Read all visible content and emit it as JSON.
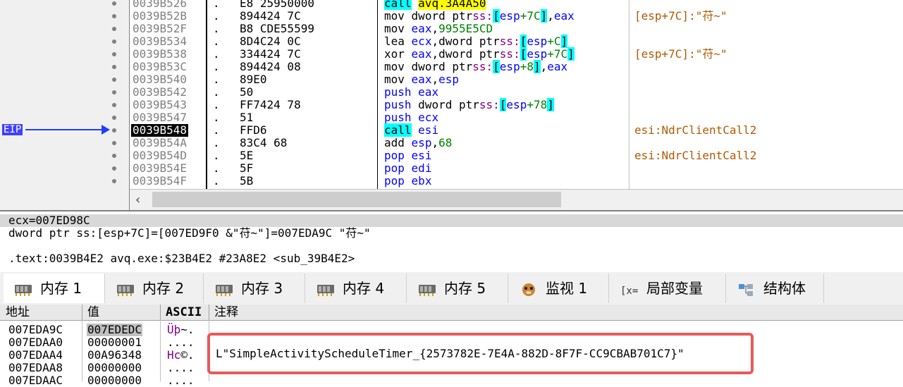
{
  "disasm": {
    "eip_label": "EIP",
    "rows": [
      {
        "addr": "0039B526",
        "sep": ".",
        "bytes": "E8 25950000",
        "mn": "call",
        "ops": [
          {
            "t": "avq.3A4A50",
            "c": "sym"
          }
        ],
        "cmt": ""
      },
      {
        "addr": "0039B52B",
        "sep": ".",
        "bytes": "894424 7C",
        "mn": "mov",
        "ops": [
          {
            "t": "dword ptr"
          },
          {
            "t": "ss:",
            "c": "seg"
          },
          {
            "t": "[",
            "c": "br"
          },
          {
            "t": "esp",
            "c": "reg"
          },
          {
            "t": "+7C",
            "c": "num"
          },
          {
            "t": "]",
            "c": "br"
          },
          {
            "t": ","
          },
          {
            "t": "eax",
            "c": "reg"
          }
        ],
        "cmt": "[esp+7C]:\"苻~\""
      },
      {
        "addr": "0039B52F",
        "sep": ".",
        "bytes": "B8 CDE55599",
        "mn": "mov",
        "ops": [
          {
            "t": "eax",
            "c": "reg"
          },
          {
            "t": ","
          },
          {
            "t": "9955E5CD",
            "c": "num"
          }
        ],
        "cmt": ""
      },
      {
        "addr": "0039B534",
        "sep": ".",
        "bytes": "8D4C24 0C",
        "mn": "lea",
        "ops": [
          {
            "t": "ecx",
            "c": "reg"
          },
          {
            "t": ","
          },
          {
            "t": "dword ptr"
          },
          {
            "t": "ss:",
            "c": "seg"
          },
          {
            "t": "[",
            "c": "br"
          },
          {
            "t": "esp",
            "c": "reg"
          },
          {
            "t": "+C",
            "c": "num"
          },
          {
            "t": "]",
            "c": "br"
          }
        ],
        "cmt": ""
      },
      {
        "addr": "0039B538",
        "sep": ".",
        "bytes": "334424 7C",
        "mn": "xor",
        "ops": [
          {
            "t": "eax",
            "c": "reg"
          },
          {
            "t": ","
          },
          {
            "t": "dword ptr"
          },
          {
            "t": "ss:",
            "c": "seg"
          },
          {
            "t": "[",
            "c": "br"
          },
          {
            "t": "esp",
            "c": "reg"
          },
          {
            "t": "+7C",
            "c": "num"
          },
          {
            "t": "]",
            "c": "br"
          }
        ],
        "cmt": "[esp+7C]:\"苻~\""
      },
      {
        "addr": "0039B53C",
        "sep": ".",
        "bytes": "894424 08",
        "mn": "mov",
        "ops": [
          {
            "t": "dword ptr"
          },
          {
            "t": "ss:",
            "c": "seg"
          },
          {
            "t": "[",
            "c": "br"
          },
          {
            "t": "esp",
            "c": "reg"
          },
          {
            "t": "+8",
            "c": "num"
          },
          {
            "t": "]",
            "c": "br"
          },
          {
            "t": ","
          },
          {
            "t": "eax",
            "c": "reg"
          }
        ],
        "cmt": ""
      },
      {
        "addr": "0039B540",
        "sep": ".",
        "bytes": "89E0",
        "mn": "mov",
        "ops": [
          {
            "t": "eax",
            "c": "reg"
          },
          {
            "t": ","
          },
          {
            "t": "esp",
            "c": "reg"
          }
        ],
        "cmt": ""
      },
      {
        "addr": "0039B542",
        "sep": ".",
        "bytes": "50",
        "mn": "push",
        "ops": [
          {
            "t": "eax",
            "c": "reg"
          }
        ],
        "cmt": ""
      },
      {
        "addr": "0039B543",
        "sep": ".",
        "bytes": "FF7424 78",
        "mn": "push",
        "ops": [
          {
            "t": "dword ptr"
          },
          {
            "t": "ss:",
            "c": "seg"
          },
          {
            "t": "[",
            "c": "br"
          },
          {
            "t": "esp",
            "c": "reg"
          },
          {
            "t": "+78",
            "c": "num"
          },
          {
            "t": "]",
            "c": "br"
          }
        ],
        "cmt": ""
      },
      {
        "addr": "0039B547",
        "sep": ".",
        "bytes": "51",
        "mn": "push",
        "ops": [
          {
            "t": "ecx",
            "c": "reg"
          }
        ],
        "cmt": ""
      },
      {
        "addr": "0039B548",
        "sep": ".",
        "bytes": "FFD6",
        "mn": "call",
        "ops": [
          {
            "t": "esi",
            "c": "reg"
          }
        ],
        "cmt": "esi:NdrClientCall2",
        "current": true
      },
      {
        "addr": "0039B54A",
        "sep": ".",
        "bytes": "83C4 68",
        "mn": "add",
        "ops": [
          {
            "t": "esp",
            "c": "reg"
          },
          {
            "t": ","
          },
          {
            "t": "68",
            "c": "num"
          }
        ],
        "cmt": ""
      },
      {
        "addr": "0039B54D",
        "sep": ".",
        "bytes": "5E",
        "mn": "pop",
        "ops": [
          {
            "t": "esi",
            "c": "reg"
          }
        ],
        "cmt": "esi:NdrClientCall2"
      },
      {
        "addr": "0039B54E",
        "sep": ".",
        "bytes": "5F",
        "mn": "pop",
        "ops": [
          {
            "t": "edi",
            "c": "reg"
          }
        ],
        "cmt": ""
      },
      {
        "addr": "0039B54F",
        "sep": ".",
        "bytes": "5B",
        "mn": "pop",
        "ops": [
          {
            "t": "ebx",
            "c": "reg"
          }
        ],
        "cmt": ""
      }
    ]
  },
  "info": {
    "line1": "ecx=007ED98C",
    "line2": "dword ptr ss:[esp+7C]=[007ED9F0 &\"苻~\"]=007EDA9C \"苻~\"",
    "line3": ".text:0039B4E2 avq.exe:$23B4E2 #23A8E2 <sub_39B4E2>"
  },
  "tabs": [
    {
      "label": "内存 1",
      "icon": "memory-icon",
      "active": true
    },
    {
      "label": "内存 2",
      "icon": "memory-icon"
    },
    {
      "label": "内存 3",
      "icon": "memory-icon"
    },
    {
      "label": "内存 4",
      "icon": "memory-icon"
    },
    {
      "label": "内存 5",
      "icon": "memory-icon"
    },
    {
      "label": "监视 1",
      "icon": "watch-icon"
    },
    {
      "label": "局部变量",
      "icon": "locals-icon"
    },
    {
      "label": "结构体",
      "icon": "struct-icon"
    }
  ],
  "dump": {
    "headers": {
      "addr": "地址",
      "value": "值",
      "ascii": "ASCII",
      "comment": "注释"
    },
    "rows": [
      {
        "addr": "007EDA9C",
        "value": "007EDEDC",
        "ascii": "Üþ~.",
        "selected": true
      },
      {
        "addr": "007EDAA0",
        "value": "00000001",
        "ascii": "...."
      },
      {
        "addr": "007EDAA4",
        "value": "00A96348",
        "ascii": "Hc©.",
        "comment": "L\"SimpleActivityScheduleTimer_{2573782E-7E4A-882D-8F7F-CC9CBAB701C7}\""
      },
      {
        "addr": "007EDAA8",
        "value": "00000000",
        "ascii": "...."
      },
      {
        "addr": "007EDAAC",
        "value": "00000000",
        "ascii": "...."
      }
    ]
  },
  "colors": {
    "highlight_box": "#e8595a",
    "eip_arrow": "#2040ff",
    "call_bg": "#00ffff",
    "symbol_bg": "#ffff00"
  }
}
